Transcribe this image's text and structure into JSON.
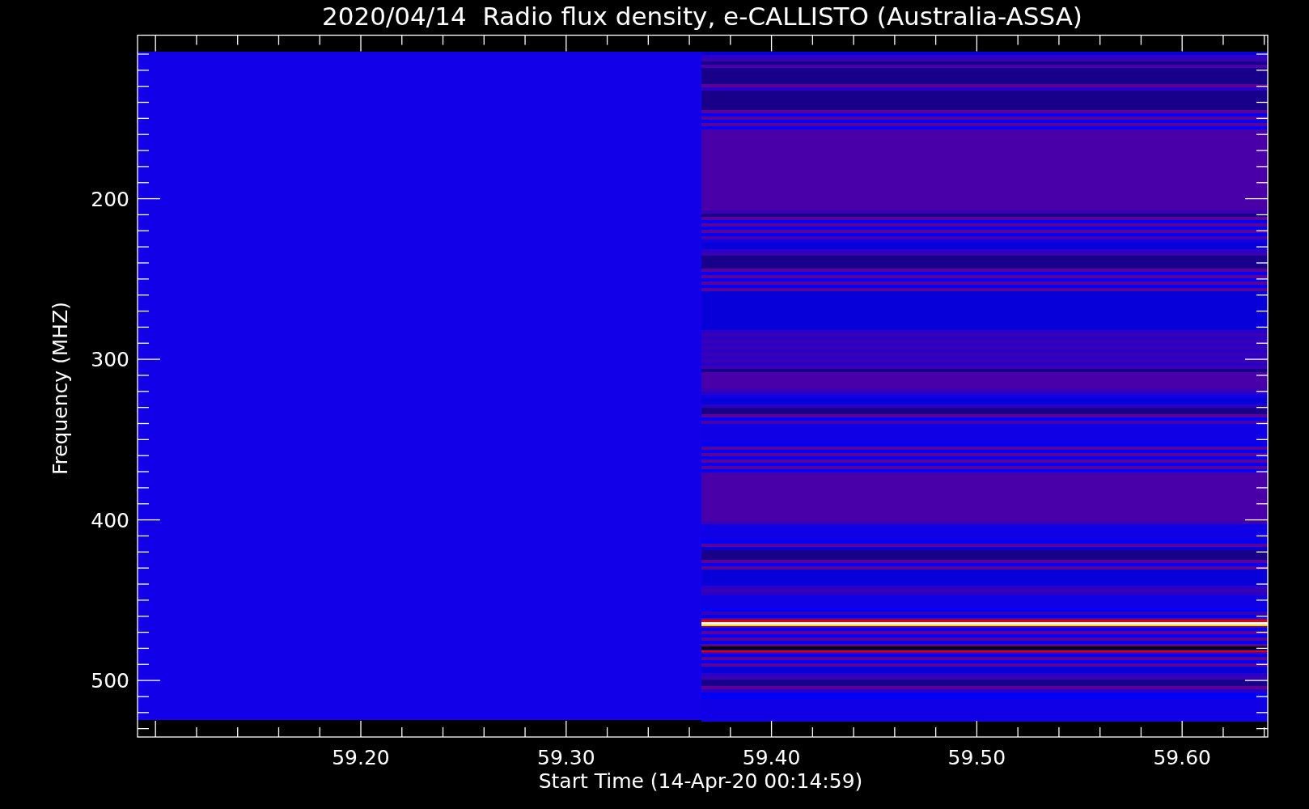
{
  "title": "2020/04/14  Radio flux density, e-CALLISTO (Australia-ASSA)",
  "y_axis": {
    "label": "Frequency (MHZ)",
    "ticks": [
      "200",
      "300",
      "400",
      "500"
    ]
  },
  "x_axis": {
    "label": "Start Time (14-Apr-20 00:14:59)",
    "ticks": [
      "59.20",
      "59.30",
      "59.40",
      "59.50",
      "59.60"
    ]
  }
}
